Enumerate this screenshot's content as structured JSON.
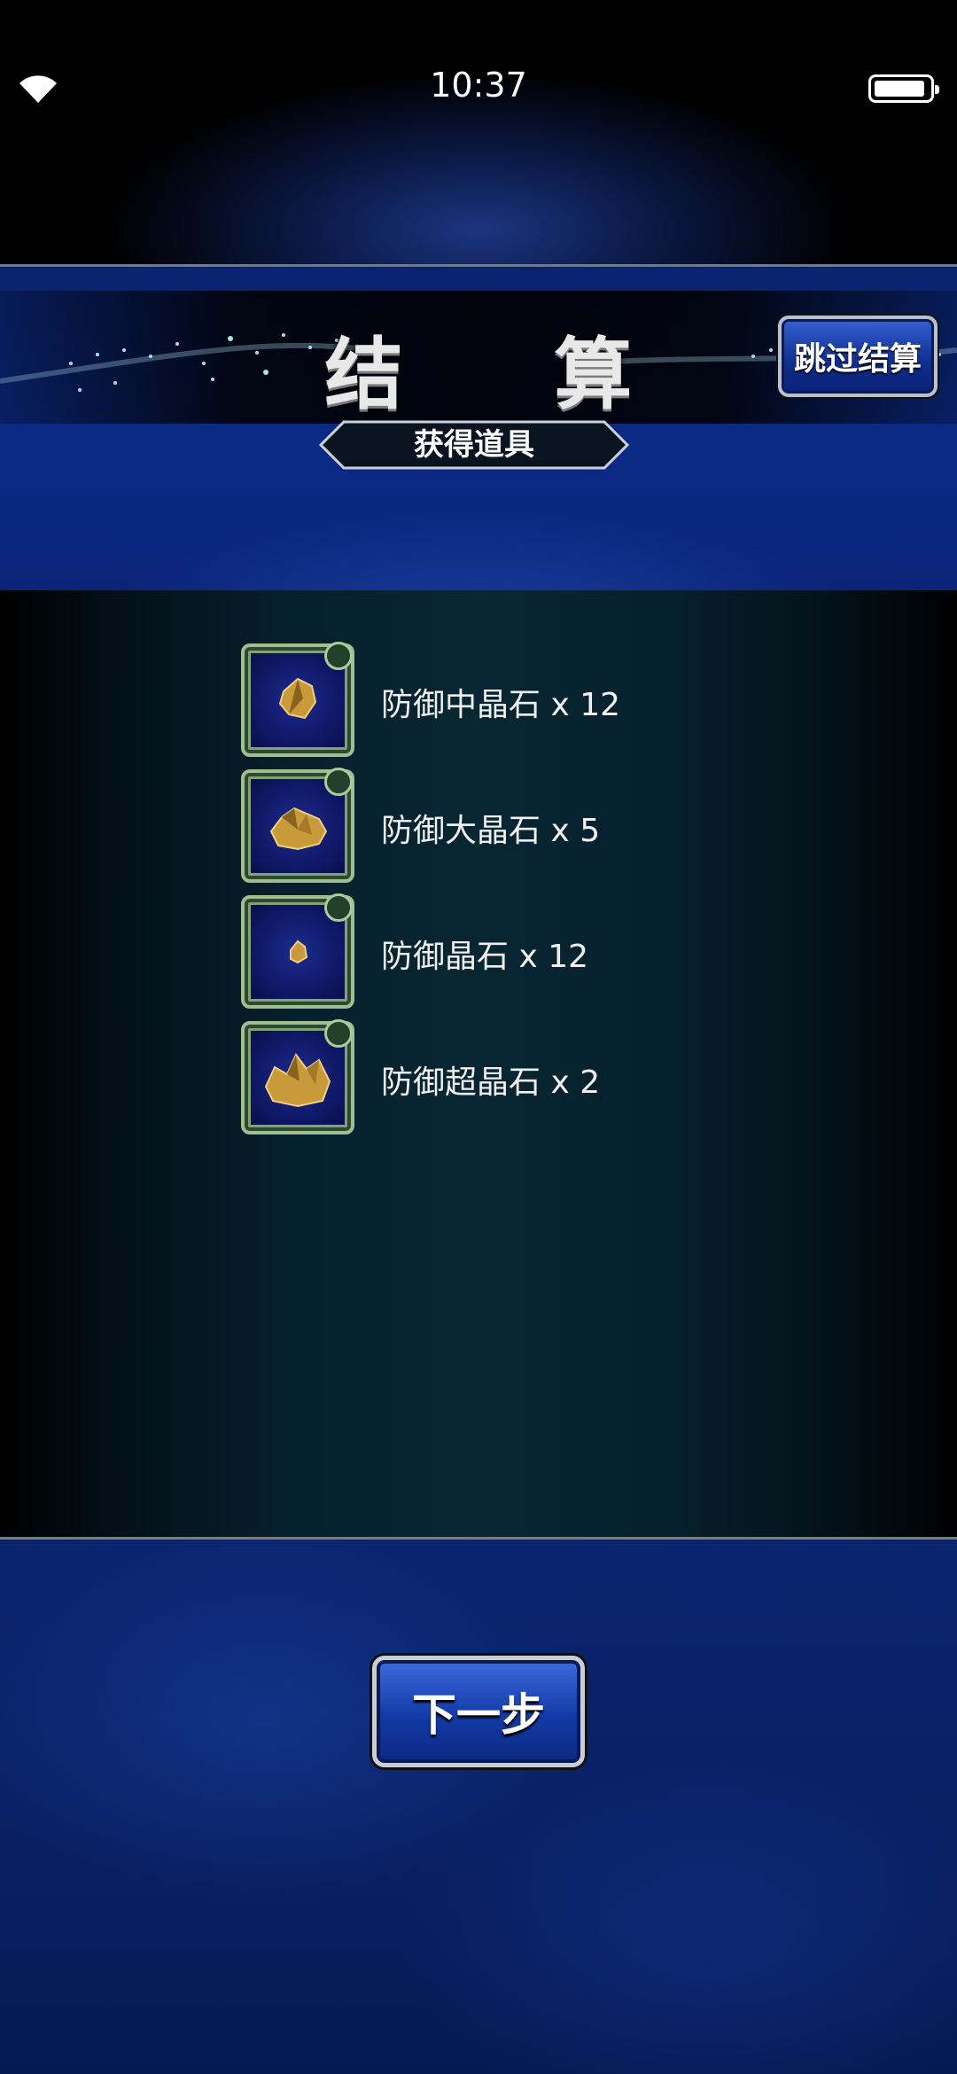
{
  "status_bar": {
    "time": "10:37",
    "wifi_icon": "wifi-icon",
    "battery_icon": "battery-icon"
  },
  "header": {
    "title": "结 算",
    "skip_button": "跳过结算",
    "subtitle": "获得道具"
  },
  "items": [
    {
      "name": "防御中晶石 x 12",
      "icon": "crystal-medium-icon"
    },
    {
      "name": "防御大晶石 x 5",
      "icon": "crystal-large-icon"
    },
    {
      "name": "防御晶石 x 12",
      "icon": "crystal-small-icon"
    },
    {
      "name": "防御超晶石 x 2",
      "icon": "crystal-super-icon"
    }
  ],
  "footer": {
    "next_button": "下一步"
  },
  "colors": {
    "accent_blue": "#0f2d8c",
    "panel_teal": "#082633",
    "frame_green": "#9fbf92",
    "crystal_gold": "#c99a3a"
  }
}
